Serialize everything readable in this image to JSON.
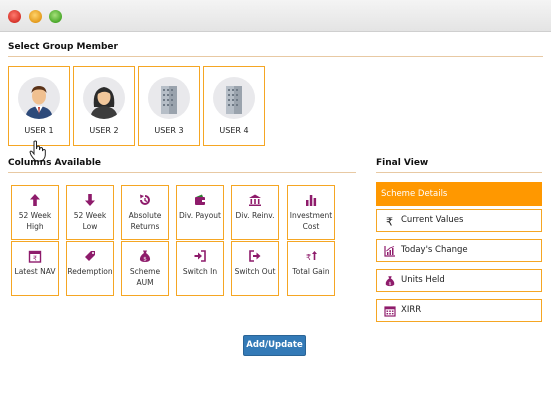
{
  "window": {
    "controls": [
      "close",
      "minimize",
      "zoom"
    ]
  },
  "group": {
    "title": "Select Group Member",
    "users": [
      {
        "label": "USER 1",
        "avatar": "male-user-icon"
      },
      {
        "label": "USER 2",
        "avatar": "female-user-icon"
      },
      {
        "label": "USER 3",
        "avatar": "building-icon"
      },
      {
        "label": "USER 4",
        "avatar": "building-icon"
      }
    ]
  },
  "columns": {
    "title": "Columns Available",
    "items": [
      {
        "label": "52 Week High",
        "icon": "arrow-up-icon"
      },
      {
        "label": "52 Week Low",
        "icon": "arrow-down-icon"
      },
      {
        "label": "Absolute Returns",
        "icon": "refresh-icon"
      },
      {
        "label": "Div. Payout",
        "icon": "wallet-icon"
      },
      {
        "label": "Div. Reinv.",
        "icon": "bank-icon"
      },
      {
        "label": "Investment Cost",
        "icon": "bar-chart-icon"
      },
      {
        "label": "Latest NAV",
        "icon": "rupee-calendar-icon"
      },
      {
        "label": "Redemption",
        "icon": "tag-icon"
      },
      {
        "label": "Scheme AUM",
        "icon": "money-bag-icon"
      },
      {
        "label": "Switch In",
        "icon": "sign-in-icon"
      },
      {
        "label": "Switch Out",
        "icon": "sign-out-icon"
      },
      {
        "label": "Total Gain",
        "icon": "rupee-arrow-icon"
      }
    ]
  },
  "final_view": {
    "title": "Final View",
    "header": "Scheme Details",
    "items": [
      {
        "label": "Current Values",
        "icon": "rupee-icon"
      },
      {
        "label": "Today's Change",
        "icon": "growth-chart-icon"
      },
      {
        "label": "Units Held",
        "icon": "money-bag-icon"
      },
      {
        "label": "XIRR",
        "icon": "calendar-icon"
      }
    ]
  },
  "actions": {
    "add_update": "Add/Update"
  },
  "colors": {
    "accent": "#ff9800",
    "border": "#f5a623",
    "icon": "#8e1b6b",
    "button": "#337ab7"
  }
}
